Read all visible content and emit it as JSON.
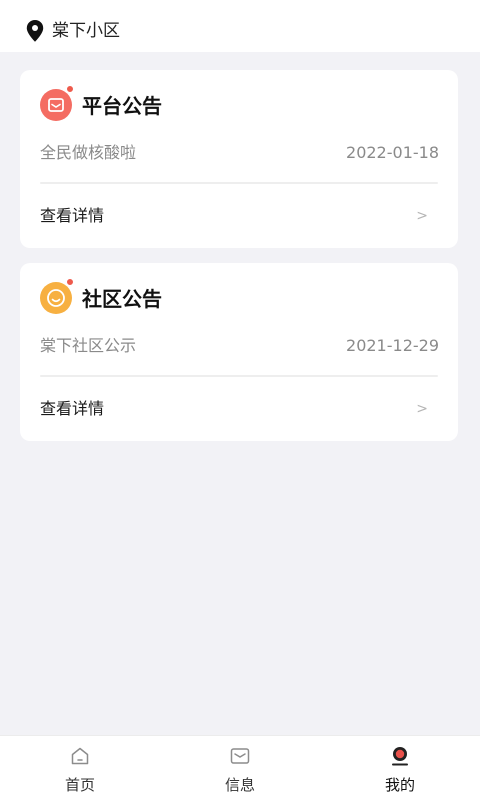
{
  "header": {
    "location_icon": "map-pin-icon",
    "location_name": "棠下小区"
  },
  "announcements": [
    {
      "icon": "envelope-icon",
      "icon_color": "#f46c62",
      "title": "平台公告",
      "subject": "全民做核酸啦",
      "date": "2022-01-18",
      "detail_label": "查看详情",
      "arrow": ">"
    },
    {
      "icon": "smiley-icon",
      "icon_color": "#f7b041",
      "title": "社区公告",
      "subject": "棠下社区公示",
      "date": "2021-12-29",
      "detail_label": "查看详情",
      "arrow": ">"
    }
  ],
  "tabbar": {
    "tabs": [
      {
        "label": "首页",
        "icon": "home-icon",
        "active": false
      },
      {
        "label": "信息",
        "icon": "mail-icon",
        "active": false
      },
      {
        "label": "我的",
        "icon": "profile-icon",
        "active": true
      }
    ]
  },
  "colors": {
    "background": "#f2f2f6",
    "card": "#ffffff",
    "badge_dot": "#ee5a4c",
    "active_tab_accent": "#e8504a"
  }
}
